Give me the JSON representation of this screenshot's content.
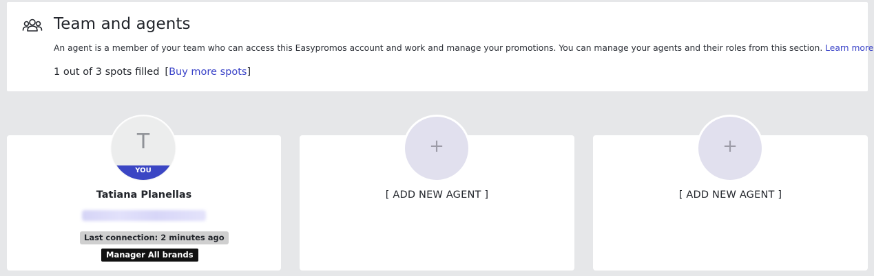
{
  "header": {
    "icon": "team-icon",
    "title": "Team and agents",
    "description": "An agent is a member of your team who can access this Easypromos account and work and manage your promotions. You can manage your agents and their roles from this section.",
    "learn_more": "Learn more",
    "spots_text": "1 out of 3 spots filled",
    "bracket_open": "[",
    "buy_more": "Buy more spots",
    "bracket_close": "]"
  },
  "agents": [
    {
      "initial": "T",
      "you_label": "YOU",
      "name": "Tatiana Planellas",
      "last_connection": "Last connection: 2 minutes ago",
      "role": "Manager All brands"
    }
  ],
  "empty_slots": [
    {
      "icon": "plus-icon",
      "symbol": "+",
      "label": "[ ADD NEW AGENT ]"
    },
    {
      "icon": "plus-icon",
      "symbol": "+",
      "label": "[ ADD NEW AGENT ]"
    }
  ],
  "colors": {
    "accent": "#3b46c4",
    "link": "#3a43c8",
    "background": "#e6e7e9",
    "add_avatar": "#e1e0ee"
  }
}
